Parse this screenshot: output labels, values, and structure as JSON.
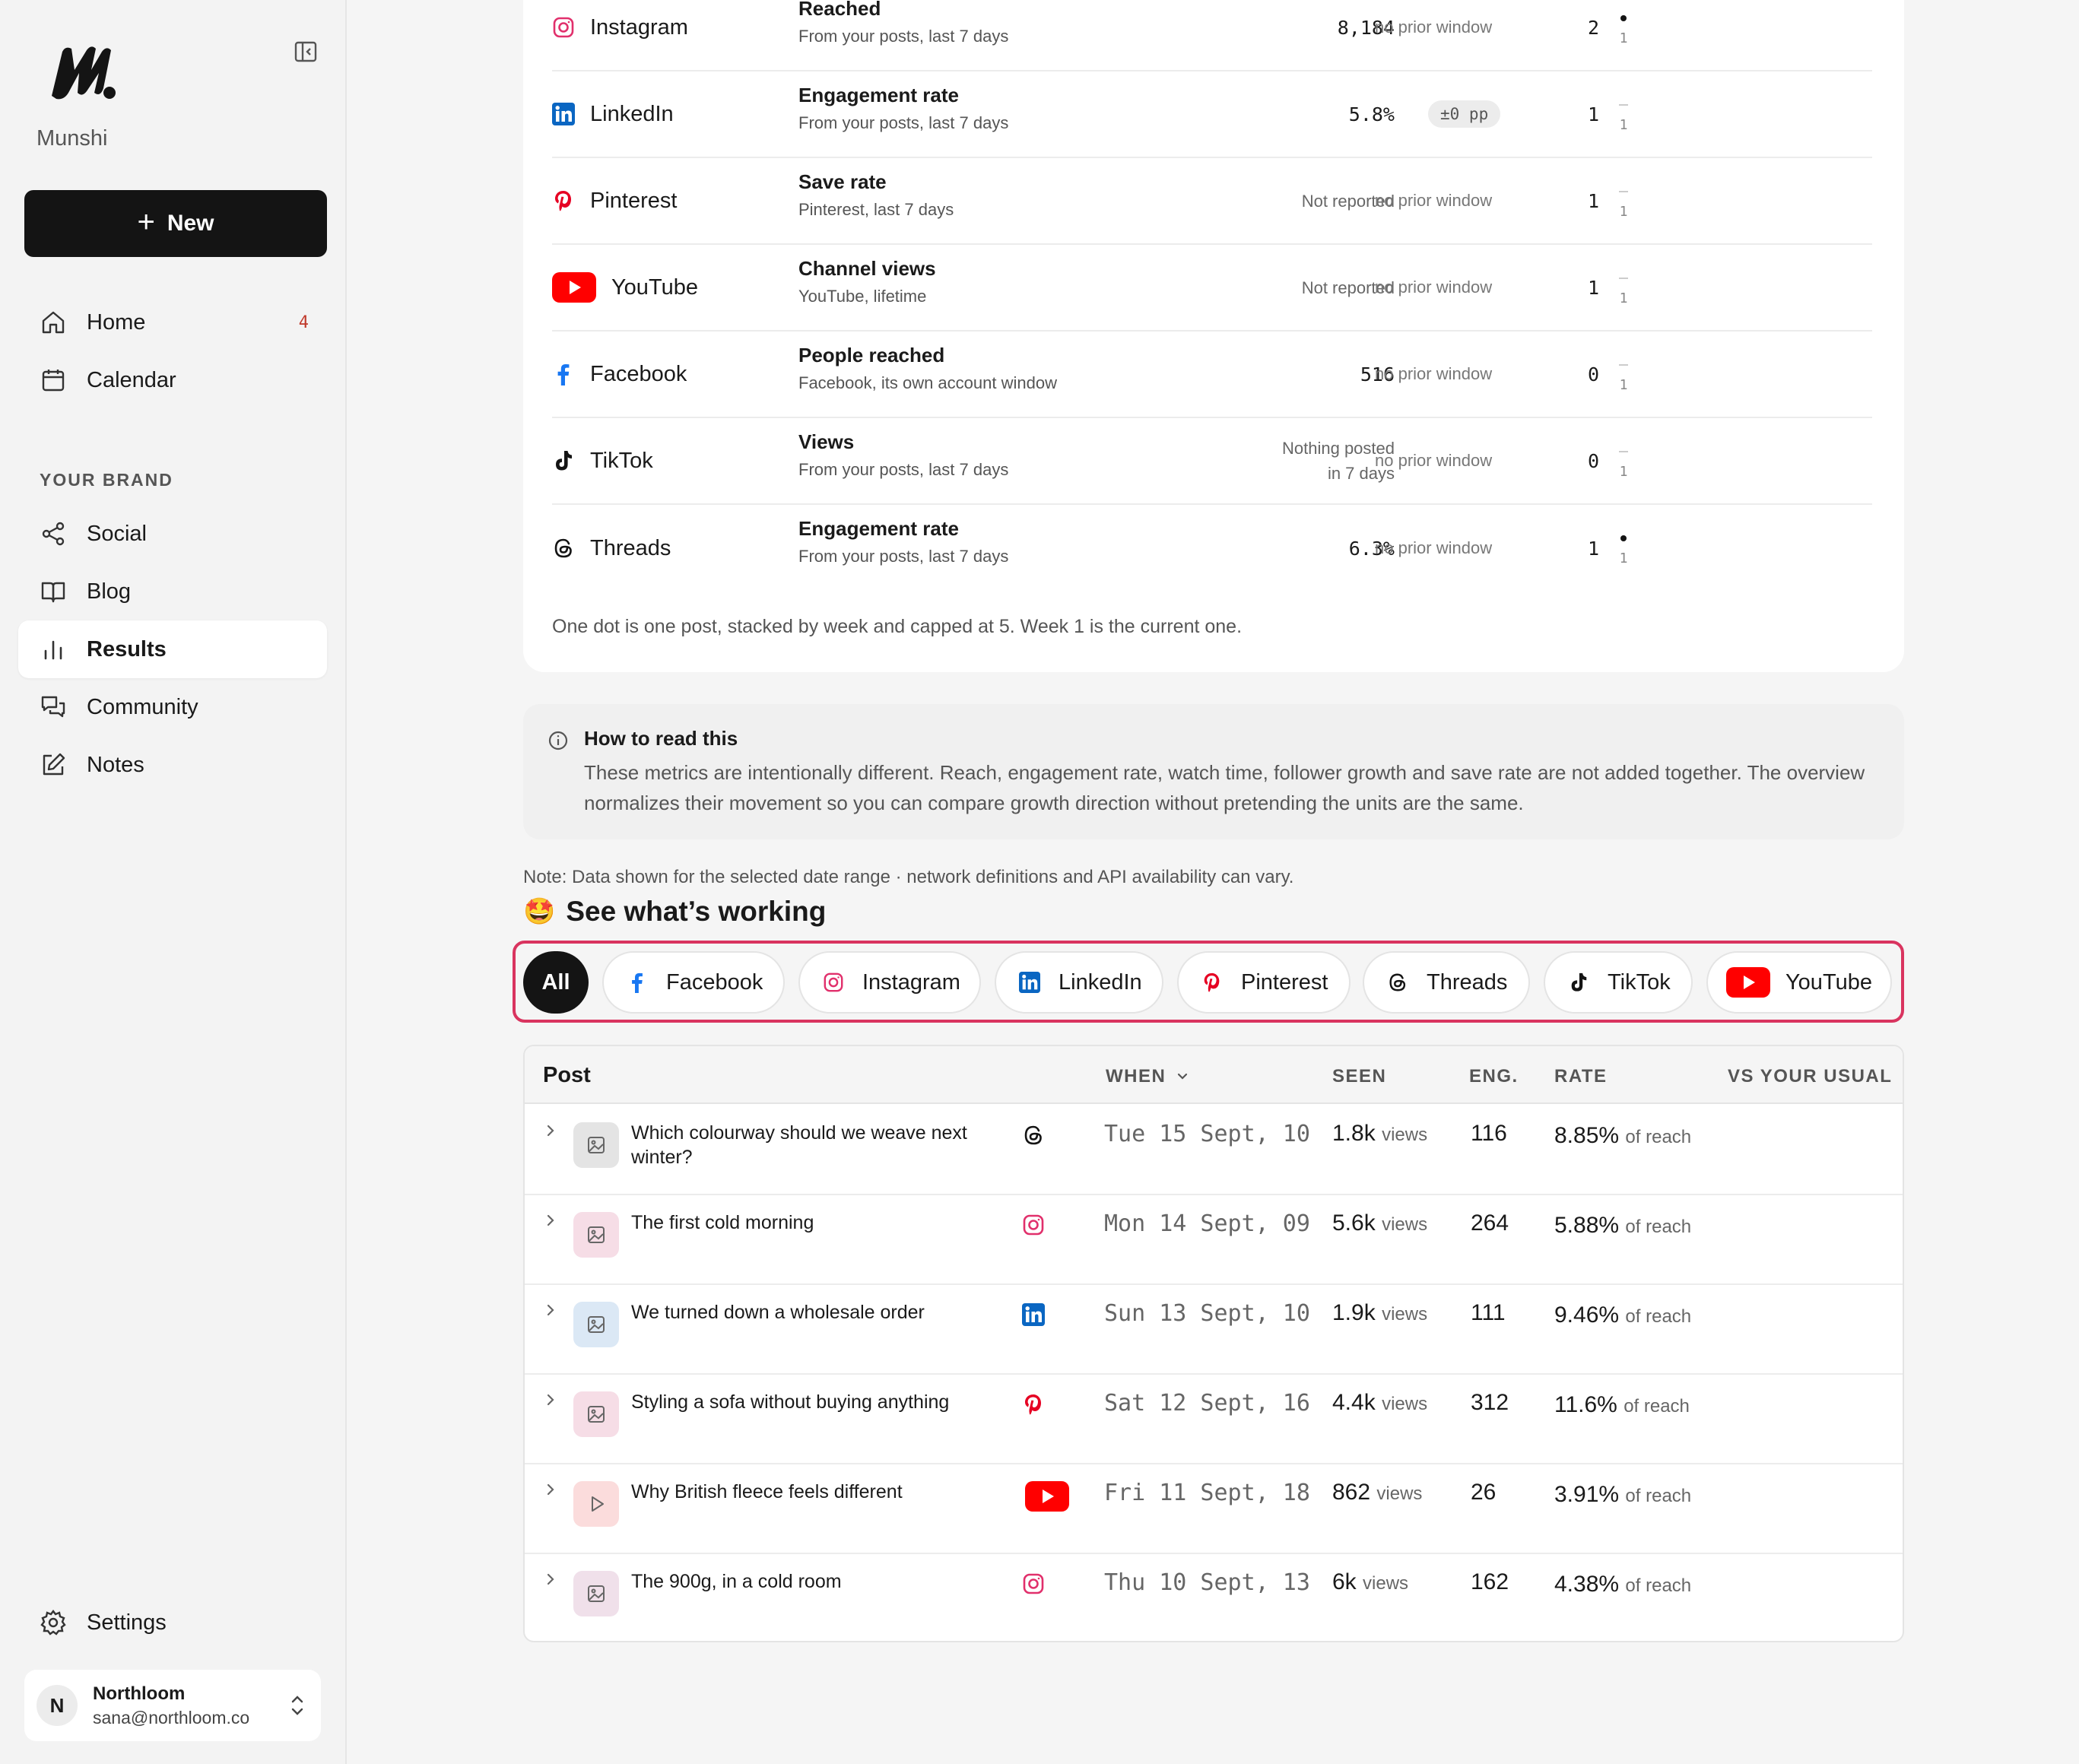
{
  "brand": {
    "name": "Munshi"
  },
  "sidebar": {
    "new_label": "New",
    "nav": [
      {
        "label": "Home",
        "badge": "4"
      },
      {
        "label": "Calendar"
      }
    ],
    "section_label": "YOUR BRAND",
    "brand_nav": [
      {
        "label": "Social"
      },
      {
        "label": "Blog"
      },
      {
        "label": "Results"
      },
      {
        "label": "Community"
      },
      {
        "label": "Notes"
      }
    ],
    "settings_label": "Settings",
    "account": {
      "initial": "N",
      "name": "Northloom",
      "email": "sana@northloom.co"
    }
  },
  "platforms": [
    {
      "name": "Instagram",
      "metric": "Reached",
      "sub": "From your posts, last 7 days",
      "value": "8,184",
      "prior": "no prior window",
      "count": "2",
      "week": "1",
      "dots": 1
    },
    {
      "name": "LinkedIn",
      "metric": "Engagement rate",
      "sub": "From your posts, last 7 days",
      "value": "5.8%",
      "prior": "±0 pp",
      "count": "1",
      "week": "1",
      "dots": 0
    },
    {
      "name": "Pinterest",
      "metric": "Save rate",
      "sub": "Pinterest, last 7 days",
      "value": "Not reported",
      "prior": "no prior window",
      "count": "1",
      "week": "1",
      "dots": 0
    },
    {
      "name": "YouTube",
      "metric": "Channel views",
      "sub": "YouTube, lifetime",
      "value": "Not reported",
      "prior": "no prior window",
      "count": "1",
      "week": "1",
      "dots": 0
    },
    {
      "name": "Facebook",
      "metric": "People reached",
      "sub": "Facebook, its own account window",
      "value": "516",
      "prior": "no prior window",
      "count": "0",
      "week": "1",
      "dots": 0
    },
    {
      "name": "TikTok",
      "metric": "Views",
      "sub": "From your posts, last 7 days",
      "value_line1": "Nothing posted",
      "value_line2": "in 7 days",
      "prior": "no prior window",
      "count": "0",
      "week": "1",
      "dots": 0
    },
    {
      "name": "Threads",
      "metric": "Engagement rate",
      "sub": "From your posts, last 7 days",
      "value": "6.3%",
      "prior": "no prior window",
      "count": "1",
      "week": "1",
      "dots": 1
    }
  ],
  "platform_footnote": "One dot is one post, stacked by week and capped at 5. Week 1 is the current one.",
  "howto": {
    "title": "How to read this",
    "body": "These metrics are intentionally different. Reach, engagement rate, watch time, follower growth and save rate are not added together. The overview normalizes their movement so you can compare growth direction without pretending the units are the same."
  },
  "note": "Note: Data shown for the selected date range · network definitions and API availability can vary.",
  "working": {
    "emoji": "🤩",
    "title": "See what’s working"
  },
  "filters": [
    "All",
    "Facebook",
    "Instagram",
    "LinkedIn",
    "Pinterest",
    "Threads",
    "TikTok",
    "YouTube"
  ],
  "posts": {
    "headers": {
      "post": "Post",
      "when": "WHEN",
      "seen": "SEEN",
      "eng": "ENG.",
      "rate": "RATE",
      "vs": "VS YOUR USUAL"
    },
    "seen_unit": "views",
    "rate_unit": "of reach",
    "rows": [
      {
        "title": "Which colourway should we weave next winter?",
        "network": "Threads",
        "when": "Tue 15 Sept, 10",
        "seen": "1.8k",
        "eng": "116",
        "rate": "8.85%"
      },
      {
        "title": "The first cold morning",
        "network": "Instagram",
        "when": "Mon 14 Sept, 09",
        "seen": "5.6k",
        "eng": "264",
        "rate": "5.88%"
      },
      {
        "title": "We turned down a wholesale order",
        "network": "LinkedIn",
        "when": "Sun 13 Sept, 10",
        "seen": "1.9k",
        "eng": "111",
        "rate": "9.46%"
      },
      {
        "title": "Styling a sofa without buying anything",
        "network": "Pinterest",
        "when": "Sat 12 Sept, 16",
        "seen": "4.4k",
        "eng": "312",
        "rate": "11.6%"
      },
      {
        "title": "Why British fleece feels different",
        "network": "YouTube",
        "when": "Fri 11 Sept, 18",
        "seen": "862",
        "eng": "26",
        "rate": "3.91%"
      },
      {
        "title": "The 900g, in a cold room",
        "network": "Instagram",
        "when": "Thu 10 Sept, 13",
        "seen": "6k",
        "eng": "162",
        "rate": "4.38%"
      }
    ]
  },
  "colors": {
    "accent_highlight": "#d9345f",
    "instagram": "#e1306c",
    "linkedin": "#0a66c2",
    "pinterest": "#e60023",
    "youtube": "#ff0000",
    "facebook": "#1877f2",
    "dark": "#141414"
  }
}
